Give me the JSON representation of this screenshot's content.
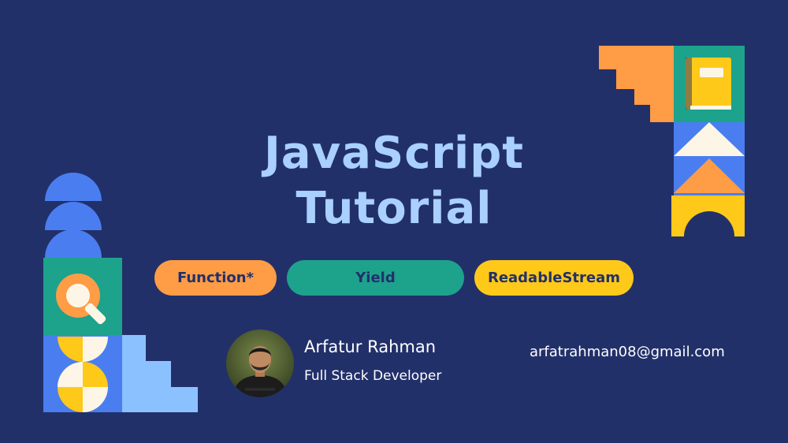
{
  "title": {
    "line1": "JavaScript",
    "line2": "Tutorial"
  },
  "tags": [
    {
      "label": "Function*",
      "color": "#ff9c46"
    },
    {
      "label": "Yield",
      "color": "#1da28c"
    },
    {
      "label": "ReadableStream",
      "color": "#ffc91a"
    }
  ],
  "author": {
    "name": "Arfatur Rahman",
    "role": "Full Stack Developer",
    "email": "arfatrahman08@gmail.com"
  },
  "icons": [
    "book-icon",
    "search-icon",
    "avatar"
  ],
  "colors": {
    "background": "#22306a",
    "title": "#a9d0ff",
    "orange": "#ff9c46",
    "teal": "#1da28c",
    "yellow": "#ffc91a",
    "blue": "#4a7ef0",
    "light_blue": "#8cc1ff",
    "cream": "#fdf6e6"
  }
}
